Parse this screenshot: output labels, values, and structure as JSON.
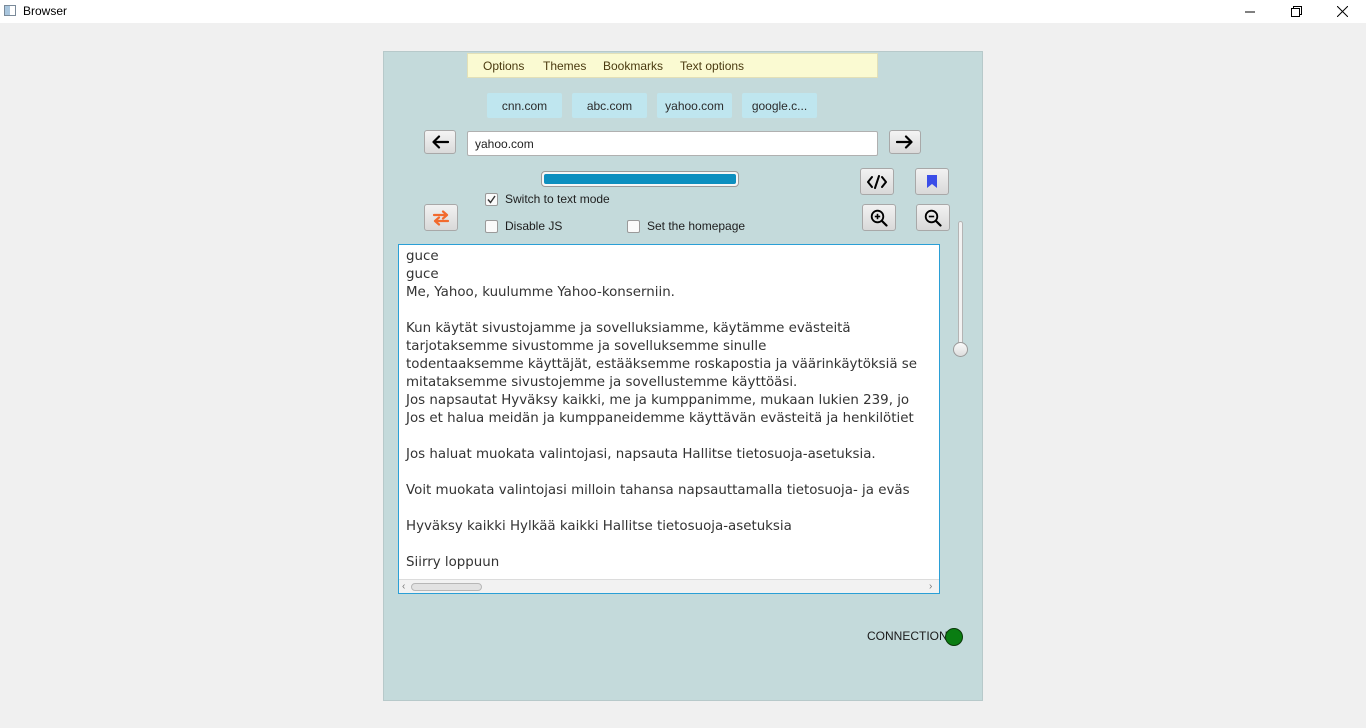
{
  "window": {
    "title": "Browser",
    "controls": [
      "minimize-icon",
      "restore-icon",
      "close-icon"
    ]
  },
  "menu": {
    "items": [
      "Options",
      "Themes",
      "Bookmarks",
      "Text options"
    ]
  },
  "quick_links": [
    "cnn.com",
    "abc.com",
    "yahoo.com",
    "google.c..."
  ],
  "navigation": {
    "back_icon": "arrow-left-icon",
    "forward_icon": "arrow-right-icon",
    "url_value": "yahoo.com"
  },
  "progress": {
    "value": 1.0,
    "color": "#0d8fbf"
  },
  "options": {
    "text_mode": {
      "label": "Switch to text mode",
      "checked": true
    },
    "disable_js": {
      "label": "Disable JS",
      "checked": false
    },
    "homepage": {
      "label": "Set the homepage",
      "checked": false
    }
  },
  "toolbar": {
    "swap_icon": "swap-arrows-icon",
    "source_icon": "code-icon",
    "bookmark_icon": "bookmark-icon",
    "zoom_in_icon": "zoom-in-icon",
    "zoom_out_icon": "zoom-out-icon"
  },
  "zoom_slider": {
    "value": 0.0
  },
  "page_text": "guce\nguce\nMe, Yahoo, kuulumme Yahoo-konserniin.\n\nKun käytät sivustojamme ja sovelluksiamme, käytämme evästeitä\ntarjotaksemme sivustomme ja sovelluksemme sinulle\ntodentaaksemme käyttäjät, estääksemme roskapostia ja väärinkäytöksiä se\nmitataksemme sivustojemme ja sovellustemme käyttöäsi.\nJos napsautat Hyväksy kaikki, me ja kumppanimme, mukaan lukien 239, jo\nJos et halua meidän ja kumppaneidemme käyttävän evästeitä ja henkilötiet\n\nJos haluat muokata valintojasi, napsauta Hallitse tietosuoja-asetuksia.\n\nVoit muokata valintojasi milloin tahansa napsauttamalla tietosuoja- ja eväs\n\nHyväksy kaikki Hylkää kaikki Hallitse tietosuoja-asetuksia\n\nSiirry loppuun",
  "status": {
    "connection_label": "CONNECTION",
    "connection_color": "#0a7d12"
  },
  "colors": {
    "panel_bg": "#c4dadb",
    "menu_bg": "#fafad2",
    "link_bg": "#bfe6ef",
    "accent": "#2a9fd6"
  }
}
